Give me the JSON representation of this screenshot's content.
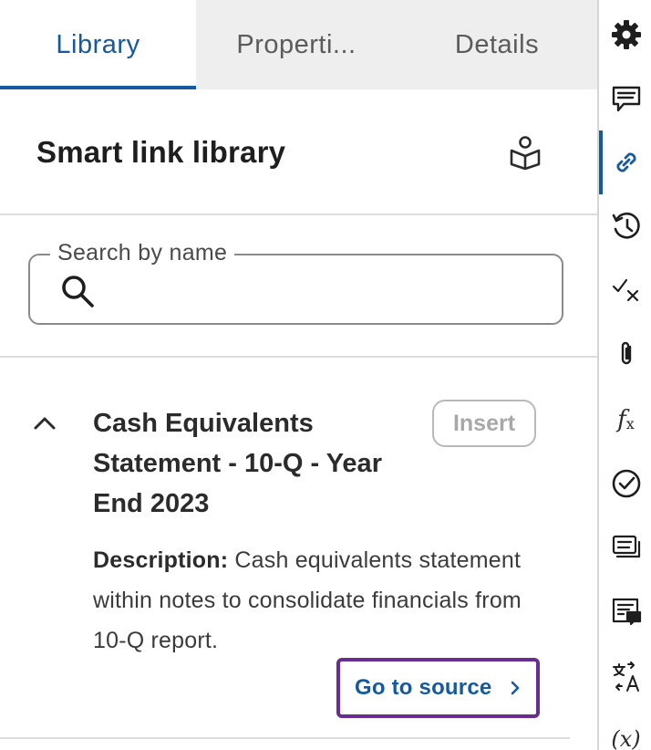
{
  "tabs": [
    {
      "label": "Library"
    },
    {
      "label": "Properti..."
    },
    {
      "label": "Details"
    }
  ],
  "header": {
    "title": "Smart link library",
    "icon": "library-book-icon"
  },
  "search": {
    "label": "Search by name",
    "value": "",
    "placeholder": ""
  },
  "item": {
    "title": "Cash Equivalents Statement - 10-Q - Year End 2023",
    "insert_label": "Insert",
    "description_label": "Description:",
    "description_text": " Cash equivalents statement within notes to consolidate financials from 10-Q report.",
    "goto_label": "Go to source"
  },
  "rail": {
    "icons": [
      "gear-icon",
      "comment-icon",
      "link-icon",
      "history-icon",
      "check-cross-icon",
      "paperclip-icon",
      "function-icon",
      "check-circle-icon",
      "list-cards-icon",
      "note-icon",
      "translate-icon",
      "variable-icon"
    ],
    "active": "link-icon"
  },
  "colors": {
    "accent": "#15599f",
    "focus_outline": "#6a2c91",
    "inactive_tab_bg": "#eeeeee",
    "disabled_text": "#a8a8a8"
  }
}
